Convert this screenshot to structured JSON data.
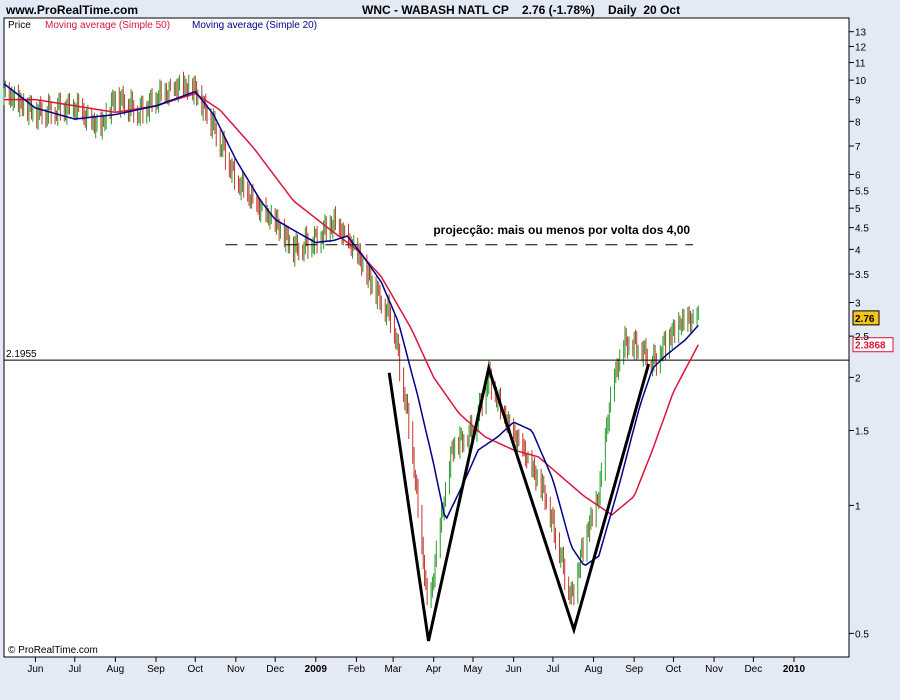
{
  "header": {
    "site": "www.ProRealTime.com",
    "title": "WNC - WABASH NATL CP    2.76 (-1.78%)    Daily  20 Oct"
  },
  "legend": {
    "price": "Price",
    "ma50": "Moving average (Simple 50)",
    "ma20": "Moving average (Simple 20)"
  },
  "footer": {
    "copyright": "© ProRealTime.com"
  },
  "colors": {
    "background": "#ffffff",
    "page": "#e3eaf5",
    "up_bar": "#2a9a2a",
    "down_bar": "#c0392b",
    "ma50": "#dc143c",
    "ma20": "#00008b",
    "pattern": "#000000",
    "price_badge": "#f5c518",
    "ma50_badge": "#dc143c"
  },
  "chart_data": {
    "type": "line",
    "scale": "log",
    "ylim": [
      0.44,
      14
    ],
    "y_ticks": [
      0.5,
      1,
      1.5,
      2,
      2.5,
      3,
      3.5,
      4,
      4.5,
      5,
      5.5,
      6,
      7,
      8,
      9,
      10,
      11,
      12,
      13
    ],
    "x_ticks": [
      "Jun",
      "Jul",
      "Aug",
      "Sep",
      "Oct",
      "Nov",
      "Dec",
      "2009",
      "Feb",
      "Mar",
      "Apr",
      "May",
      "Jun",
      "Jul",
      "Aug",
      "Sep",
      "Oct",
      "Nov",
      "Dec",
      "2010"
    ],
    "x_tick_dates": [
      "2008-06-01",
      "2008-07-01",
      "2008-08-01",
      "2008-09-01",
      "2008-10-01",
      "2008-11-01",
      "2008-12-01",
      "2009-01-01",
      "2009-02-01",
      "2009-03-01",
      "2009-04-01",
      "2009-05-01",
      "2009-06-01",
      "2009-07-01",
      "2009-08-01",
      "2009-09-01",
      "2009-10-01",
      "2009-11-01",
      "2009-12-01",
      "2010-01-01"
    ],
    "x_range": [
      "2008-05-08",
      "2010-02-12"
    ],
    "horizontal_line": {
      "value": 2.1955,
      "label": "2.1955"
    },
    "projection": {
      "value": 4.1,
      "start": "2008-10-24",
      "end": "2009-10-16",
      "text": "projecção: mais ou menos por volta dos 4,00"
    },
    "last_price": {
      "value": 2.76,
      "label": "2.76"
    },
    "ma50_last": {
      "value": 2.3868,
      "label": "2.3868"
    },
    "price_anchors": [
      [
        "2008-05-08",
        9.2
      ],
      [
        "2008-06-01",
        8.4
      ],
      [
        "2008-07-01",
        8.6
      ],
      [
        "2008-07-20",
        7.6
      ],
      [
        "2008-08-01",
        9.1
      ],
      [
        "2008-08-20",
        8.4
      ],
      [
        "2008-09-01",
        9.0
      ],
      [
        "2008-09-20",
        9.6
      ],
      [
        "2008-10-01",
        9.4
      ],
      [
        "2008-10-15",
        7.8
      ],
      [
        "2008-11-01",
        5.8
      ],
      [
        "2008-11-20",
        4.9
      ],
      [
        "2008-12-01",
        4.6
      ],
      [
        "2008-12-15",
        4.0
      ],
      [
        "2009-01-01",
        4.2
      ],
      [
        "2009-01-15",
        4.6
      ],
      [
        "2009-02-01",
        3.9
      ],
      [
        "2009-02-15",
        3.2
      ],
      [
        "2009-03-01",
        2.7
      ],
      [
        "2009-03-15",
        1.4
      ],
      [
        "2009-03-28",
        0.55
      ],
      [
        "2009-04-05",
        0.85
      ],
      [
        "2009-04-15",
        1.35
      ],
      [
        "2009-05-01",
        1.5
      ],
      [
        "2009-05-13",
        2.0
      ],
      [
        "2009-05-25",
        1.6
      ],
      [
        "2009-06-10",
        1.3
      ],
      [
        "2009-06-25",
        1.05
      ],
      [
        "2009-07-05",
        0.8
      ],
      [
        "2009-07-15",
        0.6
      ],
      [
        "2009-07-25",
        0.82
      ],
      [
        "2009-08-05",
        1.05
      ],
      [
        "2009-08-15",
        1.9
      ],
      [
        "2009-08-25",
        2.4
      ],
      [
        "2009-09-05",
        2.35
      ],
      [
        "2009-09-15",
        2.15
      ],
      [
        "2009-09-25",
        2.4
      ],
      [
        "2009-10-05",
        2.65
      ],
      [
        "2009-10-20",
        2.76
      ]
    ],
    "ma20": [
      [
        "2008-05-08",
        9.8
      ],
      [
        "2008-06-01",
        8.6
      ],
      [
        "2008-07-01",
        8.1
      ],
      [
        "2008-08-01",
        8.3
      ],
      [
        "2008-09-01",
        8.7
      ],
      [
        "2008-10-01",
        9.4
      ],
      [
        "2008-10-15",
        8.3
      ],
      [
        "2008-11-01",
        6.5
      ],
      [
        "2008-11-20",
        5.2
      ],
      [
        "2008-12-01",
        4.7
      ],
      [
        "2008-12-20",
        4.35
      ],
      [
        "2009-01-01",
        4.15
      ],
      [
        "2009-01-15",
        4.2
      ],
      [
        "2009-01-25",
        4.3
      ],
      [
        "2009-02-05",
        3.9
      ],
      [
        "2009-02-20",
        3.35
      ],
      [
        "2009-03-05",
        2.7
      ],
      [
        "2009-03-20",
        1.8
      ],
      [
        "2009-04-01",
        1.25
      ],
      [
        "2009-04-10",
        0.92
      ],
      [
        "2009-04-25",
        1.15
      ],
      [
        "2009-05-05",
        1.35
      ],
      [
        "2009-05-20",
        1.45
      ],
      [
        "2009-06-01",
        1.57
      ],
      [
        "2009-06-15",
        1.5
      ],
      [
        "2009-07-01",
        1.15
      ],
      [
        "2009-07-15",
        0.8
      ],
      [
        "2009-07-25",
        0.72
      ],
      [
        "2009-08-05",
        0.76
      ],
      [
        "2009-08-20",
        1.1
      ],
      [
        "2009-09-05",
        1.7
      ],
      [
        "2009-09-15",
        2.1
      ],
      [
        "2009-09-25",
        2.25
      ],
      [
        "2009-10-10",
        2.45
      ],
      [
        "2009-10-20",
        2.65
      ]
    ],
    "ma50": [
      [
        "2008-05-08",
        9.0
      ],
      [
        "2008-06-01",
        9.0
      ],
      [
        "2008-07-01",
        8.7
      ],
      [
        "2008-08-01",
        8.4
      ],
      [
        "2008-09-01",
        8.7
      ],
      [
        "2008-10-01",
        9.3
      ],
      [
        "2008-10-20",
        8.5
      ],
      [
        "2008-11-15",
        6.9
      ],
      [
        "2008-12-15",
        5.2
      ],
      [
        "2009-01-10",
        4.5
      ],
      [
        "2009-02-01",
        4.0
      ],
      [
        "2009-02-20",
        3.45
      ],
      [
        "2009-03-15",
        2.6
      ],
      [
        "2009-04-01",
        2.0
      ],
      [
        "2009-04-20",
        1.65
      ],
      [
        "2009-05-10",
        1.45
      ],
      [
        "2009-06-01",
        1.35
      ],
      [
        "2009-06-20",
        1.3
      ],
      [
        "2009-07-10",
        1.15
      ],
      [
        "2009-07-25",
        1.05
      ],
      [
        "2009-08-15",
        0.95
      ],
      [
        "2009-09-01",
        1.05
      ],
      [
        "2009-09-15",
        1.35
      ],
      [
        "2009-10-01",
        1.85
      ],
      [
        "2009-10-20",
        2.3868
      ]
    ],
    "w_pattern": [
      [
        "2009-02-26",
        2.05
      ],
      [
        "2009-03-28",
        0.48
      ],
      [
        "2009-05-13",
        2.1
      ],
      [
        "2009-07-17",
        0.51
      ],
      [
        "2009-09-12",
        2.15
      ]
    ]
  }
}
